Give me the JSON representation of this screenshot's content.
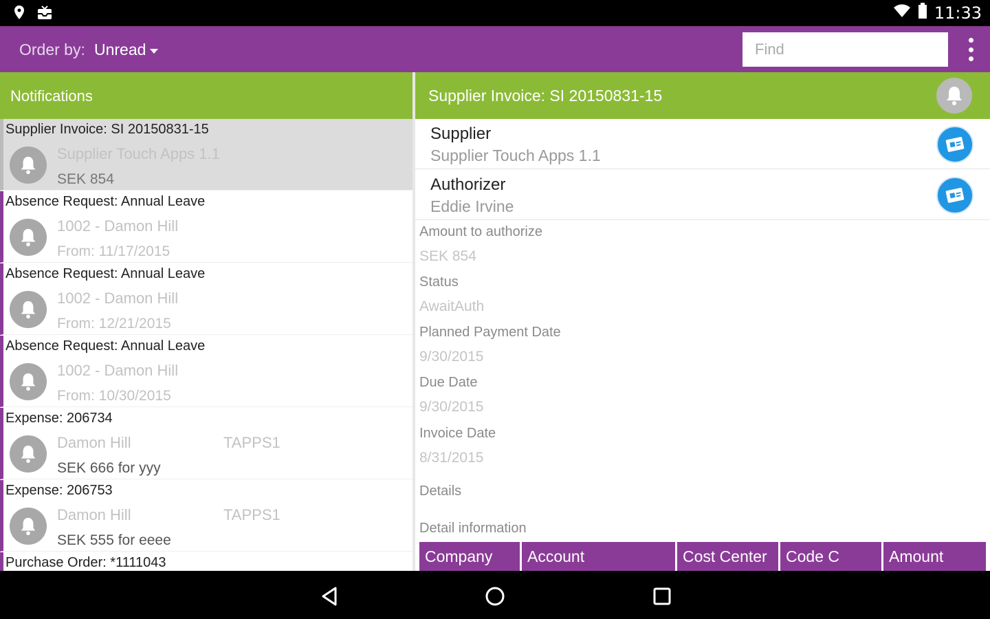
{
  "status_bar": {
    "time": "11:33",
    "icons_left": [
      "location-pin-icon",
      "inbox-icon"
    ],
    "icons_right": [
      "wifi-icon",
      "battery-icon"
    ]
  },
  "toolbar": {
    "order_label": "Order by:",
    "order_value": "Unread",
    "find_placeholder": "Find",
    "menu_icon": "more-vert-icon",
    "color": "#8a3b97"
  },
  "list_header": {
    "title": "Notifications",
    "color": "#8bbb36"
  },
  "notifications": [
    {
      "title": "Supplier Invoice: SI 20150831-15",
      "line1": "Supplier Touch Apps 1.1",
      "line1b": "",
      "line2": "SEK 854",
      "selected": true
    },
    {
      "title": "Absence Request: Annual Leave",
      "line1": "1002 - Damon Hill",
      "line1b": "",
      "line2": "From: 11/17/2015"
    },
    {
      "title": "Absence Request: Annual Leave",
      "line1": "1002 - Damon Hill",
      "line1b": "",
      "line2": "From: 12/21/2015"
    },
    {
      "title": "Absence Request: Annual Leave",
      "line1": "1002 - Damon Hill",
      "line1b": "",
      "line2": "From: 10/30/2015"
    },
    {
      "title": "Expense: 206734",
      "line1": "Damon Hill",
      "line1b": "TAPPS1",
      "line2": "SEK 666 for yyy"
    },
    {
      "title": "Expense: 206753",
      "line1": "Damon Hill",
      "line1b": "TAPPS1",
      "line2": "SEK 555 for eeee"
    },
    {
      "title": "Purchase Order: *1111043"
    }
  ],
  "detail": {
    "header_title": "Supplier Invoice: SI 20150831-15",
    "rows": [
      {
        "label": "Supplier",
        "value": "Supplier Touch Apps 1.1",
        "action_icon": "contact-card-icon"
      },
      {
        "label": "Authorizer",
        "value": "Eddie Irvine",
        "action_icon": "contact-card-icon"
      }
    ],
    "fields": [
      {
        "label": "Amount to authorize",
        "value": "SEK 854"
      },
      {
        "label": "Status",
        "value": "AwaitAuth"
      },
      {
        "label": "Planned Payment Date",
        "value": "9/30/2015"
      },
      {
        "label": "Due Date",
        "value": "9/30/2015"
      },
      {
        "label": "Invoice Date",
        "value": "8/31/2015"
      }
    ],
    "details_label": "Details",
    "detail_information_label": "Detail information",
    "table_columns": [
      "Company",
      "Account",
      "Cost Center",
      "Code C",
      "Amount"
    ]
  },
  "nav_bar": {
    "icons": [
      "back-icon",
      "home-icon",
      "recents-icon"
    ]
  }
}
